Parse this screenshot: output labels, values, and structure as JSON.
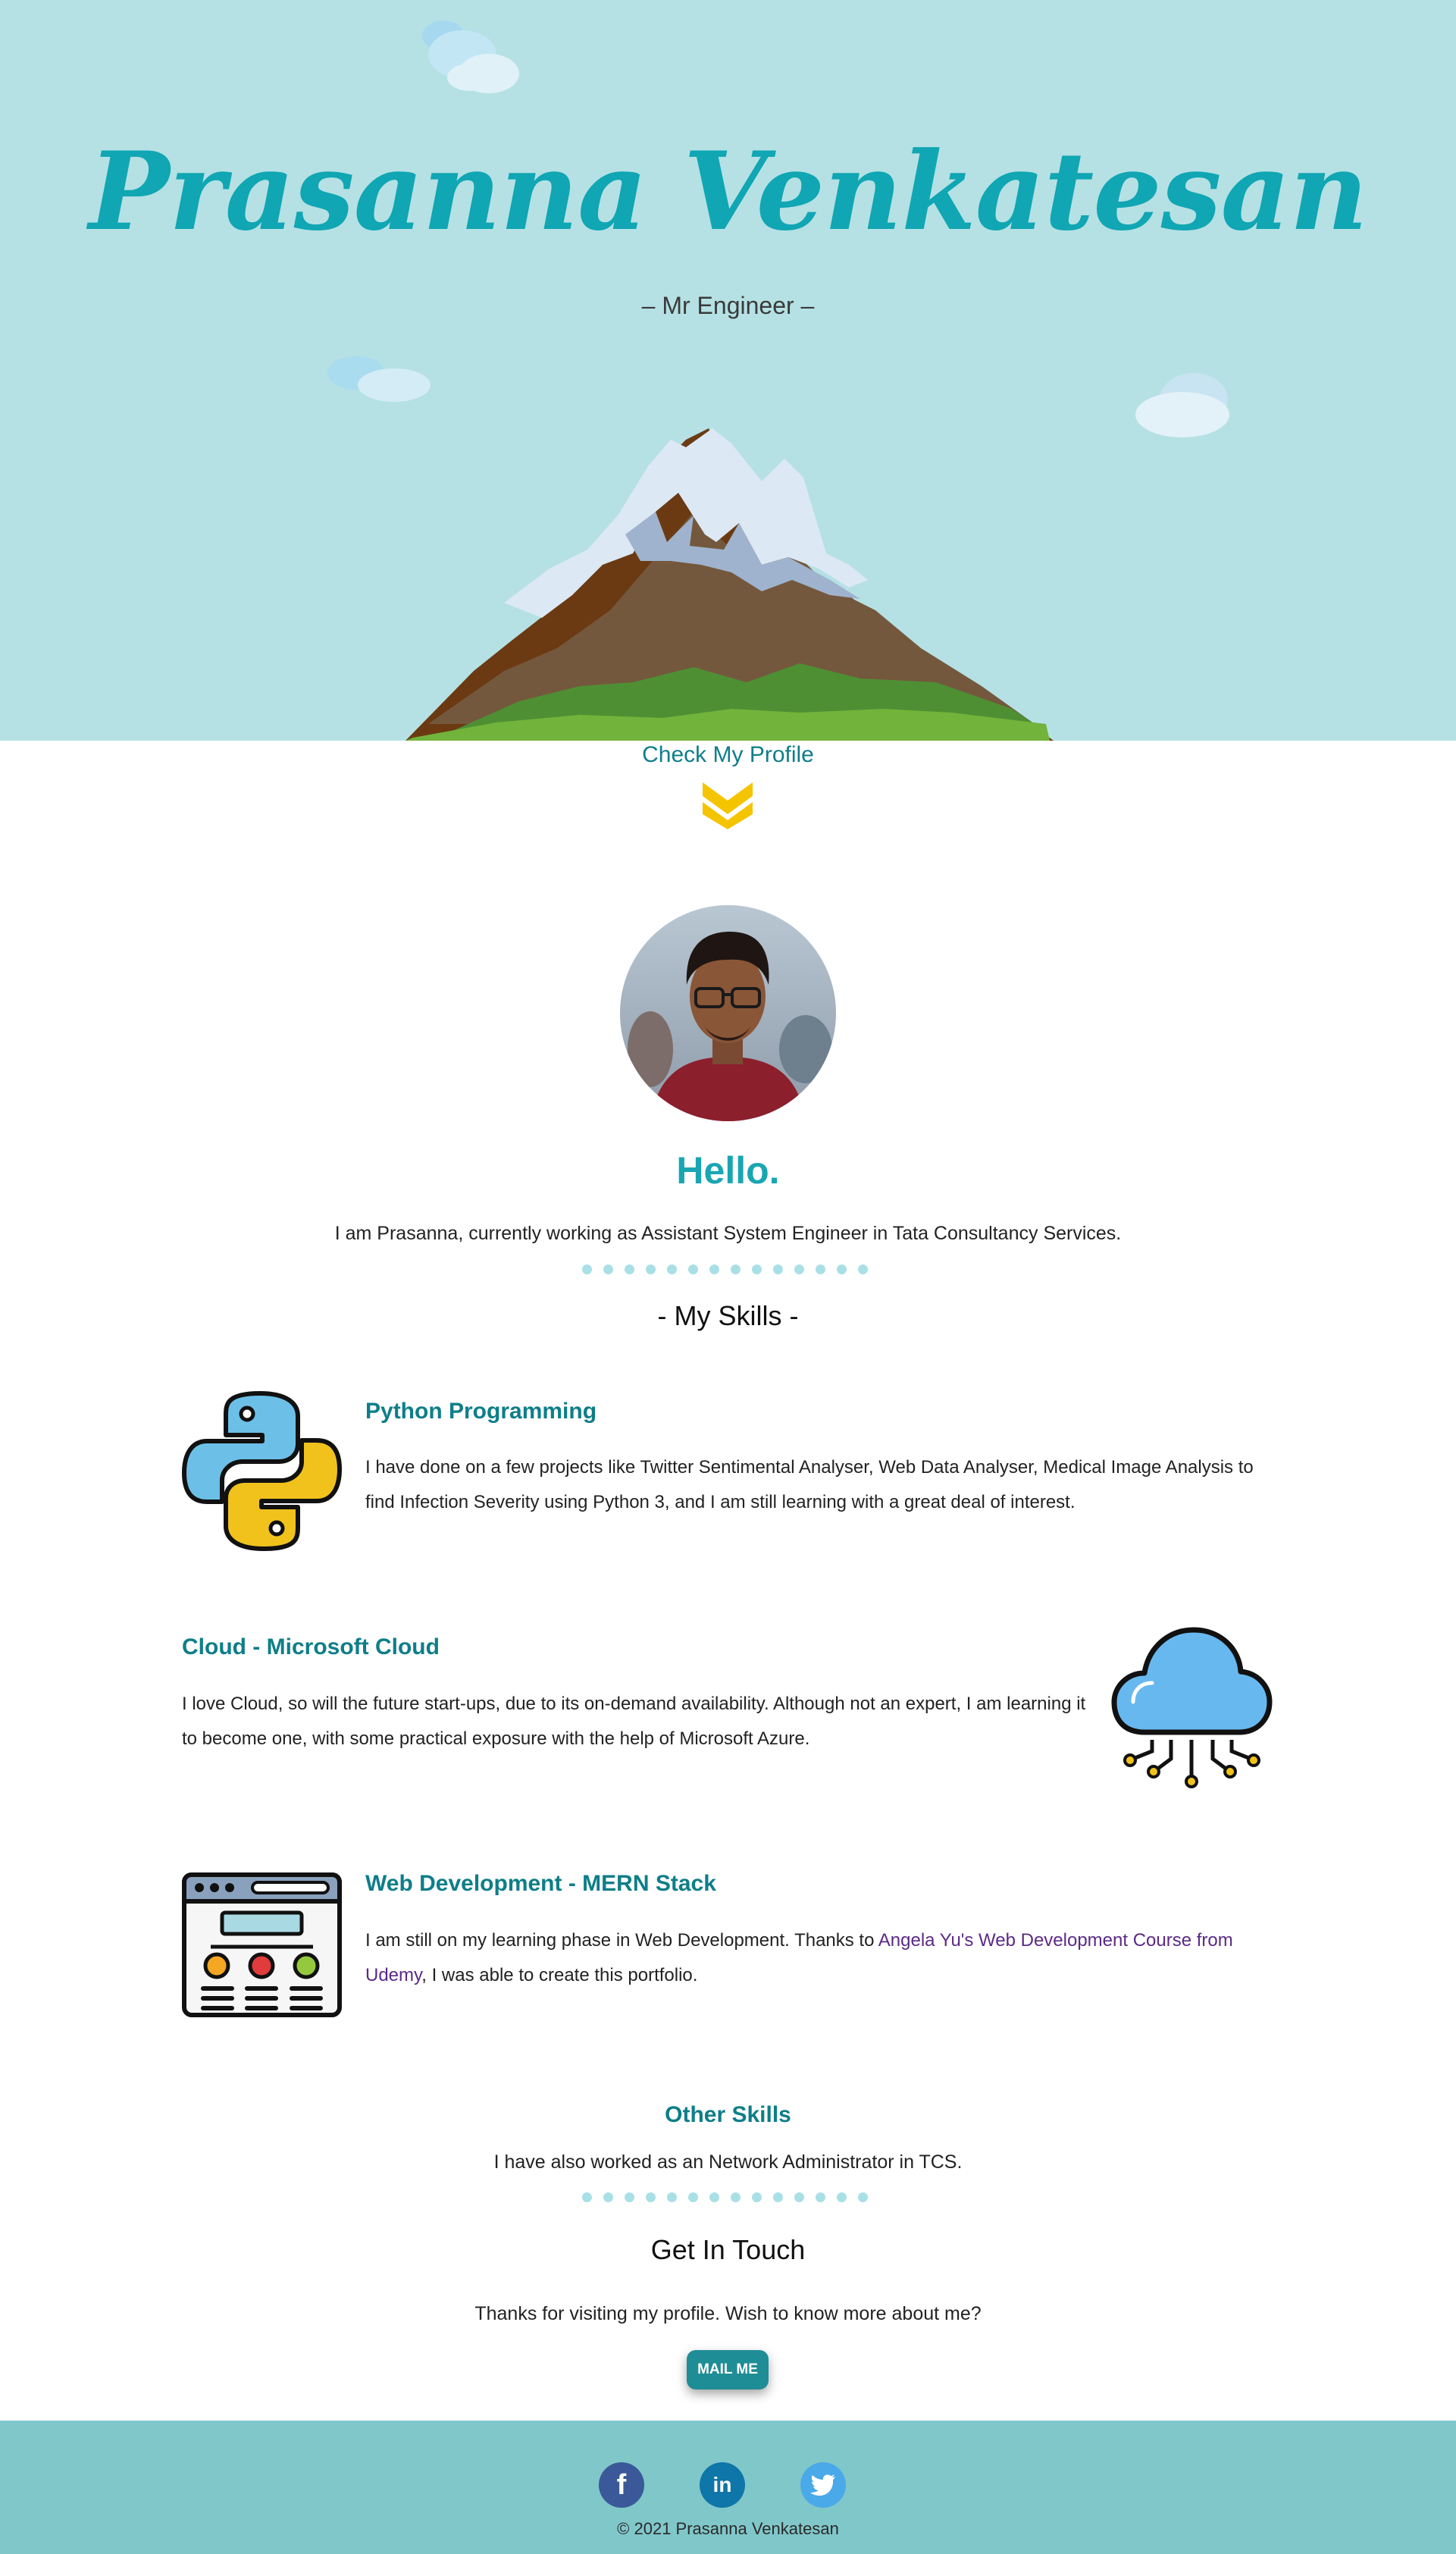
{
  "hero": {
    "title": "Prasanna Venkatesan",
    "subtitle": "– Mr Engineer –"
  },
  "check_profile": {
    "label": "Check My Profile"
  },
  "profile": {
    "hello": "Hello.",
    "intro": "I am Prasanna, currently working as Assistant System Engineer in Tata Consultancy Services."
  },
  "skills": {
    "title": "- My Skills -",
    "python": {
      "heading": "Python Programming",
      "text": "I have done on a few projects like Twitter Sentimental Analyser, Web Data Analyser, Medical Image Analysis to find Infection Severity using Python 3, and I am still learning with a great deal of interest.",
      "icon": "python-icon"
    },
    "cloud": {
      "heading": "Cloud - Microsoft Cloud",
      "text": "I love Cloud, so will the future start-ups, due to its on-demand availability. Although not an expert, I am learning it to become one, with some practical exposure with the help of Microsoft Azure.",
      "icon": "cloud-computing-icon"
    },
    "web": {
      "heading": "Web Development - MERN Stack",
      "text_before": "I am still on my learning phase in Web Development. Thanks to ",
      "link": "Angela Yu's Web Development Course from Udemy",
      "text_after": ", I was able to create this portfolio.",
      "icon": "web-browser-icon"
    },
    "other": {
      "heading": "Other Skills",
      "text": "I have also worked as an Network Administrator in TCS."
    }
  },
  "contact": {
    "title": "Get In Touch",
    "text": "Thanks for visiting my profile. Wish to know more about me?",
    "button": "MAIL ME"
  },
  "footer": {
    "social": [
      {
        "icon": "facebook-icon",
        "glyph": "f",
        "color": "#3b5998"
      },
      {
        "icon": "linkedin-icon",
        "glyph": "in",
        "color": "#0e76a8"
      },
      {
        "icon": "twitter-icon",
        "glyph": "🐦",
        "color": "#4aa9e8"
      }
    ],
    "copyright": "© 2021 Prasanna Venkatesan"
  },
  "colors": {
    "hero_bg": "#b5e1e4",
    "accent": "#10a6b3",
    "heading": "#0e7e89",
    "footer_bg": "#80c7ca",
    "chevron": "#f5c400"
  }
}
